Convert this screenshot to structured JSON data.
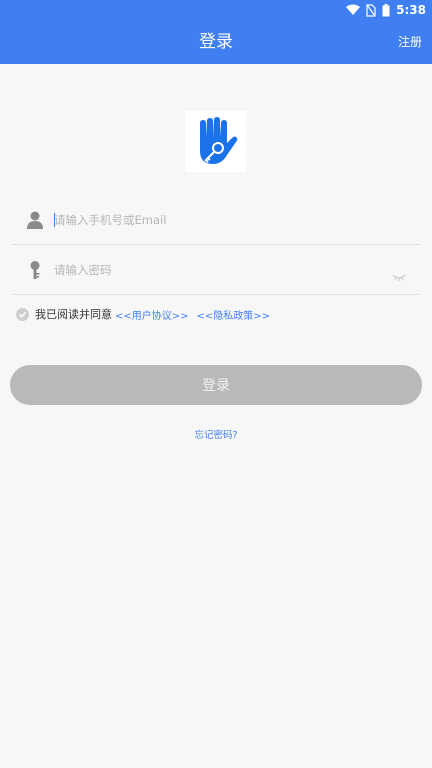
{
  "status_bar": {
    "time": "5:38",
    "icons": [
      "wifi-icon",
      "no-sim-icon",
      "battery-icon"
    ]
  },
  "app_bar": {
    "title": "登录",
    "register_label": "注册",
    "color": "#3f7ff2"
  },
  "logo": {
    "icon": "hand-key-icon"
  },
  "form": {
    "account": {
      "icon": "user-icon",
      "placeholder": "请输入手机号或Email",
      "value": ""
    },
    "password": {
      "icon": "key-icon",
      "placeholder": "请输入密码",
      "value": "",
      "toggle_icon": "eye-closed-icon"
    },
    "agreement": {
      "prefix": "我已阅读并同意",
      "user_agreement_link": "<<用户协议>>",
      "privacy_policy_link": "<<隐私政策>>",
      "checked": false
    },
    "login_button": "登录",
    "forgot_password": "忘记密码?"
  }
}
